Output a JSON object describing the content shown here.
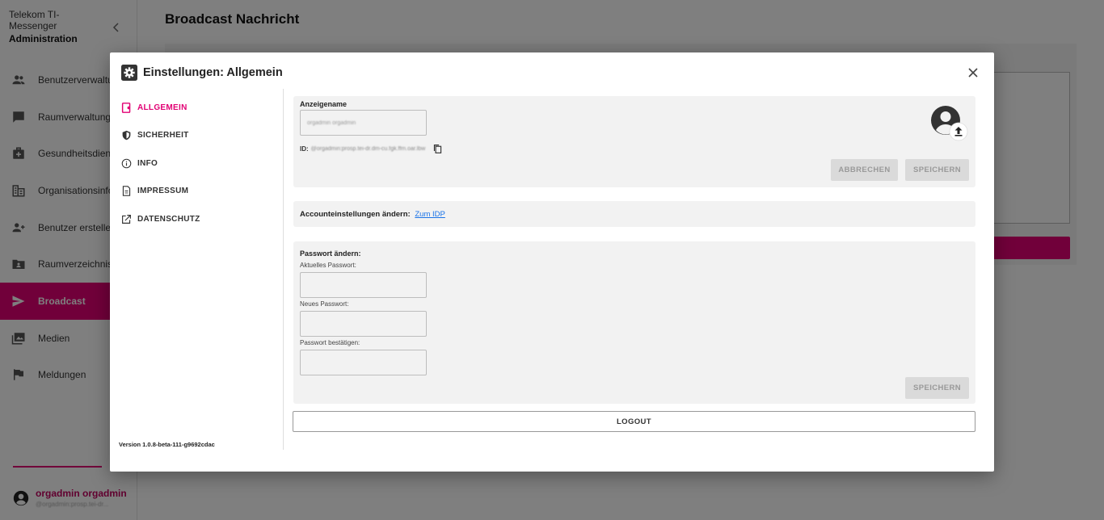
{
  "app": {
    "brand_line1": "Telekom TI-",
    "brand_line2": "Messenger",
    "brand_line3": "Administration",
    "page_title": "Broadcast Nachricht"
  },
  "sidebar": {
    "items": [
      {
        "label": "Benutzerverwaltung",
        "icon": "users-icon"
      },
      {
        "label": "Raumverwaltung",
        "icon": "chat-icon"
      },
      {
        "label": "Gesundheitsdienste",
        "icon": "medical-bag-icon"
      },
      {
        "label": "Organisationsinfo",
        "icon": "building-icon"
      },
      {
        "label": "Benutzer erstellen",
        "icon": "add-user-icon"
      },
      {
        "label": "Raumverzeichnis",
        "icon": "folder-user-icon"
      },
      {
        "label": "Broadcast",
        "icon": "send-icon",
        "active": true
      },
      {
        "label": "Medien",
        "icon": "media-icon"
      },
      {
        "label": "Meldungen",
        "icon": "flag-icon"
      }
    ],
    "user": {
      "name": "orgadmin orgadmin",
      "sub": "@orgadmin:prosp.tei-dr..."
    }
  },
  "dialog": {
    "title": "Einstellungen: Allgemein",
    "menu": [
      {
        "label": "ALLGEMEIN",
        "icon": "badge-icon",
        "active": true
      },
      {
        "label": "SICHERHEIT",
        "icon": "shield-icon"
      },
      {
        "label": "INFO",
        "icon": "info-icon"
      },
      {
        "label": "IMPRESSUM",
        "icon": "document-icon"
      },
      {
        "label": "DATENSCHUTZ",
        "icon": "external-link-icon"
      }
    ],
    "version": "Version 1.0.8-beta-111-g9692cdac",
    "profile": {
      "display_name_label": "Anzeigename",
      "display_name_value": "orgadmin orgadmin",
      "id_label": "ID:",
      "id_value": "@orgadmin:prosp.tei-dr.dm-cu.fgk.ffm.oar.lbw",
      "cancel_label": "ABBRECHEN",
      "save_label": "SPEICHERN"
    },
    "account": {
      "label": "Accounteinstellungen ändern:",
      "link": "Zum IDP"
    },
    "password": {
      "heading": "Passwort ändern:",
      "current_label": "Aktuelles Passwort:",
      "new_label": "Neues Passwort:",
      "confirm_label": "Passwort bestätigen:",
      "save_label": "SPEICHERN"
    },
    "logout_label": "LOGOUT"
  },
  "colors": {
    "accent": "#e20074",
    "link": "#1a73e8"
  }
}
